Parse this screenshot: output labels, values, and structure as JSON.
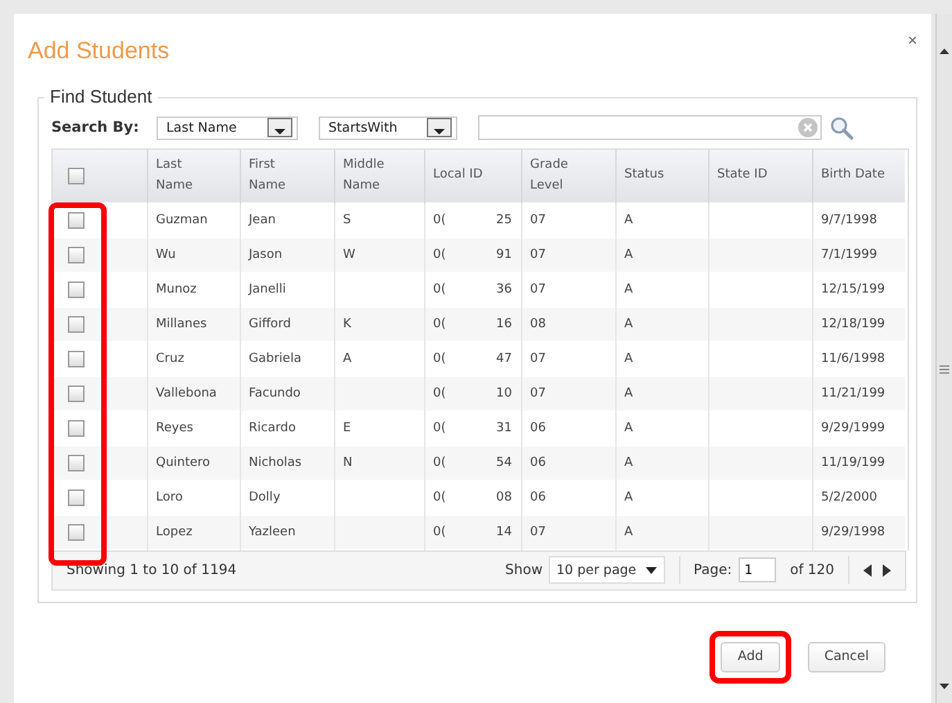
{
  "dialog": {
    "title": "Add Students",
    "close": "×"
  },
  "find": {
    "legend": "Find Student",
    "search_by": "Search By:",
    "field": "Last Name",
    "match": "StartsWith"
  },
  "table": {
    "select_all": {
      "checked": false
    },
    "columns": [
      "Last Name",
      "First Name",
      "Middle Name",
      "Local ID",
      "Grade Level",
      "Status",
      "State ID",
      "Birth Date"
    ],
    "checkbox_column_highlighted": true,
    "rows": [
      {
        "checked": false,
        "last": "Guzman",
        "first": "Jean",
        "middle": "S",
        "id_start": "0(",
        "id_end": "25",
        "grade": "07",
        "status": "A",
        "birth": "9/7/1998"
      },
      {
        "checked": false,
        "last": "Wu",
        "first": "Jason",
        "middle": "W",
        "id_start": "0(",
        "id_end": "91",
        "grade": "07",
        "status": "A",
        "birth": "7/1/1999"
      },
      {
        "checked": false,
        "last": "Munoz",
        "first": "Janelli",
        "id_start": "0(",
        "id_end": "36",
        "grade": "07",
        "status": "A",
        "birth": "12/15/199"
      },
      {
        "checked": false,
        "last": "Millanes",
        "first": "Gifford",
        "middle": "K",
        "id_start": "0(",
        "id_end": "16",
        "grade": "08",
        "status": "A",
        "birth": "12/18/199"
      },
      {
        "checked": false,
        "last": "Cruz",
        "first": "Gabriela",
        "middle": "A",
        "id_start": "0(",
        "id_end": "47",
        "grade": "07",
        "status": "A",
        "birth": "11/6/1998"
      },
      {
        "checked": false,
        "last": "Vallebona",
        "first": "Facundo",
        "id_start": "0(",
        "id_end": "10",
        "grade": "07",
        "status": "A",
        "birth": "11/21/199"
      },
      {
        "checked": false,
        "last": "Reyes",
        "first": "Ricardo",
        "middle": "E",
        "id_start": "0(",
        "id_end": "31",
        "grade": "06",
        "status": "A",
        "birth": "9/29/1999"
      },
      {
        "checked": false,
        "last": "Quintero",
        "first": "Nicholas",
        "middle": "N",
        "id_start": "0(",
        "id_end": "54",
        "grade": "06",
        "status": "A",
        "birth": "11/19/199"
      },
      {
        "checked": false,
        "last": "Loro",
        "first": "Dolly",
        "id_start": "0(",
        "id_end": "08",
        "grade": "06",
        "status": "A",
        "birth": "5/2/2000"
      },
      {
        "checked": false,
        "last": "Lopez",
        "first": "Yazleen",
        "id_start": "0(",
        "id_end": "14",
        "grade": "07",
        "status": "A",
        "birth": "9/29/1998"
      }
    ]
  },
  "pager": {
    "showing": "Showing 1 to 10 of 1194",
    "show_label": "Show",
    "per_page": "10 per page",
    "page_label": "Page:",
    "page": "1",
    "of": "of 120"
  },
  "buttons": [
    {
      "label": "Add",
      "highlighted": true
    },
    {
      "label": "Cancel",
      "highlighted": false
    }
  ]
}
